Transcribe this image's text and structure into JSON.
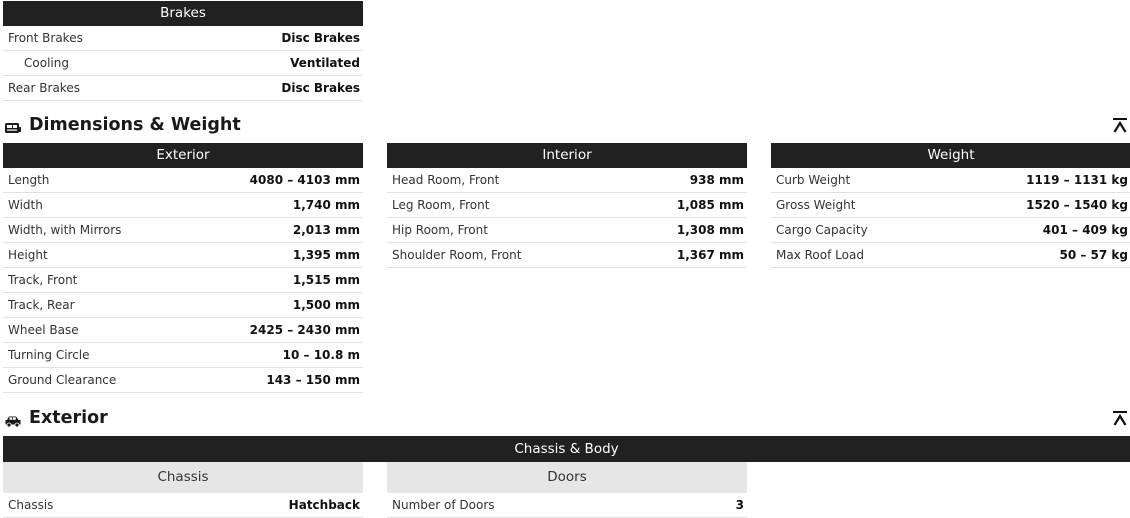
{
  "brakes": {
    "header": "Brakes",
    "rows": [
      {
        "label": "Front Brakes",
        "value": "Disc Brakes"
      },
      {
        "label": "Cooling",
        "value": "Ventilated"
      },
      {
        "label": "Rear Brakes",
        "value": "Disc Brakes"
      }
    ]
  },
  "dimensions": {
    "title": "Dimensions & Weight",
    "exterior": {
      "header": "Exterior",
      "rows": [
        {
          "label": "Length",
          "value": "4080 – 4103 mm"
        },
        {
          "label": "Width",
          "value": "1,740 mm"
        },
        {
          "label": "Width, with Mirrors",
          "value": "2,013 mm"
        },
        {
          "label": "Height",
          "value": "1,395 mm"
        },
        {
          "label": "Track, Front",
          "value": "1,515 mm"
        },
        {
          "label": "Track, Rear",
          "value": "1,500 mm"
        },
        {
          "label": "Wheel Base",
          "value": "2425 – 2430 mm"
        },
        {
          "label": "Turning Circle",
          "value": "10 – 10.8 m"
        },
        {
          "label": "Ground Clearance",
          "value": "143 – 150 mm"
        }
      ]
    },
    "interior": {
      "header": "Interior",
      "rows": [
        {
          "label": "Head Room, Front",
          "value": "938 mm"
        },
        {
          "label": "Leg Room, Front",
          "value": "1,085 mm"
        },
        {
          "label": "Hip Room, Front",
          "value": "1,308 mm"
        },
        {
          "label": "Shoulder Room, Front",
          "value": "1,367 mm"
        }
      ]
    },
    "weight": {
      "header": "Weight",
      "rows": [
        {
          "label": "Curb Weight",
          "value": "1119 – 1131 kg"
        },
        {
          "label": "Gross Weight",
          "value": "1520 – 1540 kg"
        },
        {
          "label": "Cargo Capacity",
          "value": "401 – 409 kg"
        },
        {
          "label": "Max Roof Load",
          "value": "50 – 57 kg"
        }
      ]
    }
  },
  "exterior": {
    "title": "Exterior",
    "chassis_body_header": "Chassis & Body",
    "chassis": {
      "header": "Chassis",
      "rows": [
        {
          "label": "Chassis",
          "value": "Hatchback"
        }
      ]
    },
    "doors": {
      "header": "Doors",
      "rows": [
        {
          "label": "Number of Doors",
          "value": "3"
        }
      ]
    }
  },
  "icons": {
    "dimensions_icon": "car-side-icon",
    "exterior_icon": "car-icon",
    "scroll_top_icon": "scroll-to-top-icon"
  }
}
